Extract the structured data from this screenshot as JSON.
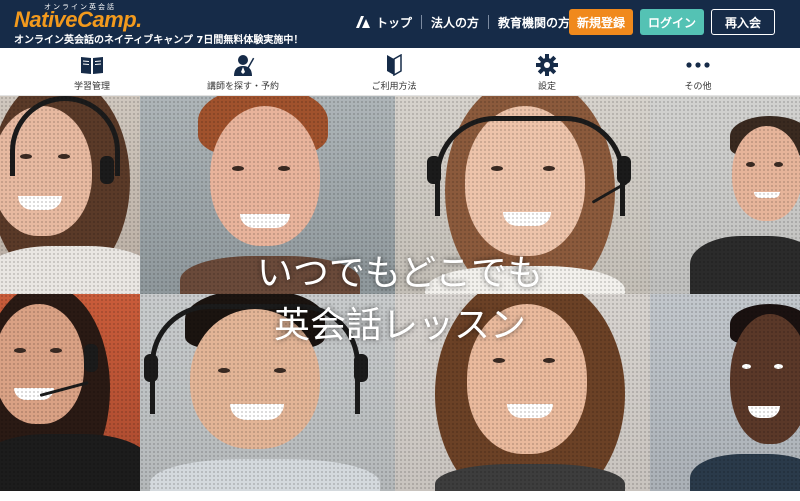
{
  "header": {
    "logo_ruby": "オンライン英会話",
    "logo": "NativeCamp.",
    "tagline": "オンライン英会話のネイティブキャンプ 7日間無料体験実施中！",
    "nav": [
      {
        "label": "トップ",
        "icon": "nativecamp-mark-icon"
      },
      {
        "label": "法人の方"
      },
      {
        "label": "教育機関の方"
      }
    ],
    "buttons": {
      "signup": "新規登録",
      "login": "ログイン",
      "rejoin": "再入会"
    },
    "colors": {
      "background": "#162b48",
      "logo": "#f39a1d",
      "signup": "#f0891c",
      "login": "#54c2b4"
    }
  },
  "menu": {
    "items": [
      {
        "label": "学習管理",
        "icon": "book-icon"
      },
      {
        "label": "講師を探す・予約",
        "icon": "teacher-icon"
      },
      {
        "label": "ご利用方法",
        "icon": "beginner-mark-icon"
      },
      {
        "label": "設定",
        "icon": "gear-icon"
      },
      {
        "label": "その他",
        "icon": "more-dots-icon"
      }
    ]
  },
  "hero": {
    "line1": "いつでもどこでも",
    "line2": "英会話レッスン"
  }
}
